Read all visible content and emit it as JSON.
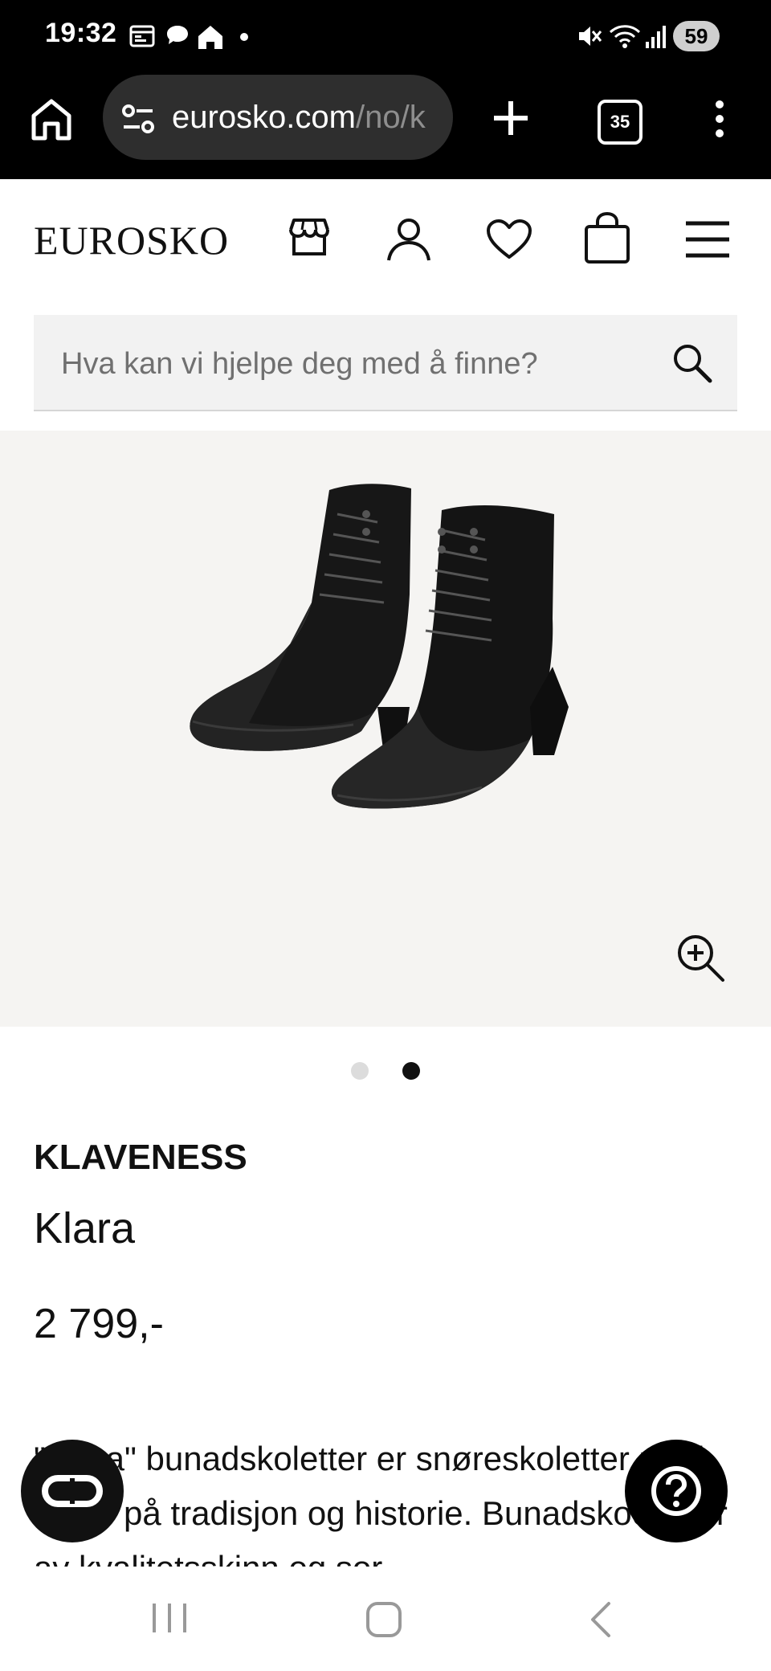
{
  "status_bar": {
    "time": "19:32",
    "battery": "59",
    "icons": [
      "calendar-icon",
      "chat-bubble-icon",
      "home-notification-icon",
      "dot-icon",
      "mute-icon",
      "wifi-icon",
      "signal-icon",
      "battery-icon"
    ]
  },
  "browser": {
    "url_main": "eurosko.com",
    "url_rest": "/no/k",
    "tab_count": "35",
    "icons": [
      "home-icon",
      "site-settings-icon",
      "plus-icon",
      "more-vert-icon"
    ]
  },
  "site_header": {
    "logo": "EUROSKO",
    "icons": [
      "store-icon",
      "account-icon",
      "heart-icon",
      "bag-icon",
      "menu-icon"
    ]
  },
  "search": {
    "placeholder": "Hva kan vi hjelpe deg med å finne?",
    "icon": "search-icon"
  },
  "gallery": {
    "image": "black lace-up bunad ankle boots",
    "slides": 2,
    "active_slide": 2,
    "zoom_icon": "zoom-in-icon"
  },
  "product": {
    "brand": "KLAVENESS",
    "name": "Klara",
    "price": "2 799,-",
    "description": "\"Klara\" bunadskoletter er snøreskoletter med fokus på tradisjon og historie. Bunadskoene er av kvalitetsskinn og sor"
  },
  "floating": {
    "chat_icon": "chat-toggle-icon",
    "help_icon": "help-icon"
  },
  "nav_bar": {
    "icons": [
      "recent-apps-icon",
      "home-nav-icon",
      "back-icon"
    ]
  }
}
